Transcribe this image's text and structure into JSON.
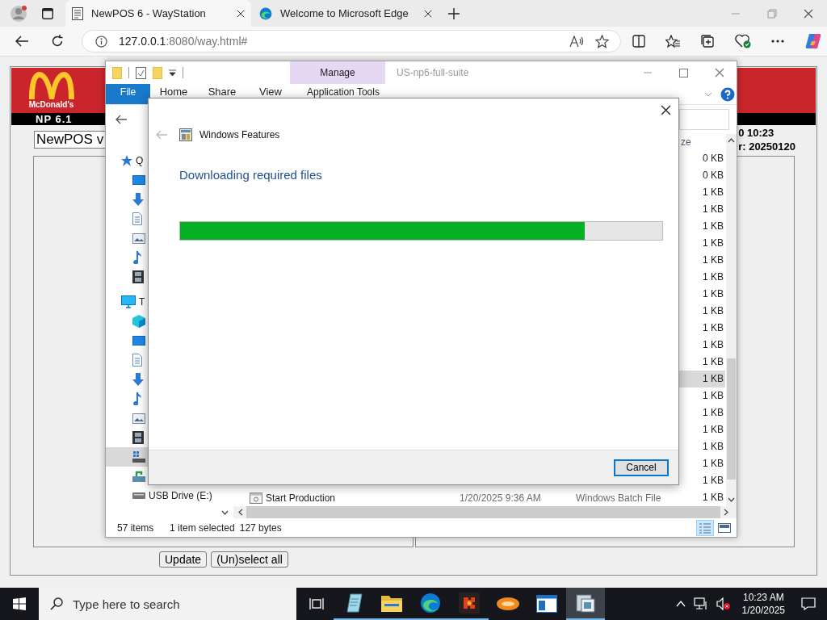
{
  "browser": {
    "tabs": [
      {
        "title": "NewPOS 6 - WayStation",
        "kind": "page",
        "selected": true
      },
      {
        "title": "Welcome to Microsoft Edge",
        "kind": "edge",
        "selected": false
      }
    ],
    "address": {
      "host": "127.0.0.1",
      "path": ":8080/way.html#"
    }
  },
  "page": {
    "logo_text": "McDonald's",
    "version_label": "NP 6.1",
    "version_field": "NewPOS v",
    "info_lines": [
      "0 10:23",
      "r: 20250120"
    ],
    "buttons": [
      "Update",
      "(Un)select all"
    ]
  },
  "explorer": {
    "context_tab": "Manage",
    "title": "US-np6-full-suite",
    "ribbon_tabs": [
      {
        "label": "File",
        "kind": "file"
      },
      {
        "label": "Home",
        "kind": "tab"
      },
      {
        "label": "Share",
        "kind": "tab"
      },
      {
        "label": "View",
        "kind": "tab"
      },
      {
        "label": "Application Tools",
        "kind": "context"
      }
    ],
    "sidebar": [
      {
        "kind": "star",
        "label": "Q",
        "selected": false,
        "children": [
          {
            "kind": "desktop",
            "selected": false
          },
          {
            "kind": "download",
            "selected": false
          },
          {
            "kind": "document",
            "selected": false
          },
          {
            "kind": "picture",
            "selected": false
          },
          {
            "kind": "music",
            "selected": false
          },
          {
            "kind": "video",
            "selected": false
          }
        ]
      },
      {
        "kind": "pc",
        "label": "T",
        "selected": false,
        "children": [
          {
            "kind": "cube",
            "selected": false
          },
          {
            "kind": "desktop",
            "selected": false
          },
          {
            "kind": "document",
            "selected": false
          },
          {
            "kind": "download",
            "selected": false
          },
          {
            "kind": "music",
            "selected": false
          },
          {
            "kind": "picture",
            "selected": false
          },
          {
            "kind": "video",
            "selected": false
          },
          {
            "kind": "drive",
            "selected": true
          },
          {
            "kind": "netdrive",
            "selected": false
          },
          {
            "kind": "usb",
            "label": "USB Drive (E:)",
            "selected": false
          }
        ]
      }
    ],
    "columns": [
      {
        "label": "ze"
      }
    ],
    "rows": [
      {
        "size": "0 KB",
        "selected": false
      },
      {
        "size": "0 KB",
        "selected": false
      },
      {
        "size": "1 KB",
        "selected": false
      },
      {
        "size": "1 KB",
        "selected": false
      },
      {
        "size": "1 KB",
        "selected": false
      },
      {
        "size": "1 KB",
        "selected": false
      },
      {
        "size": "1 KB",
        "selected": false
      },
      {
        "size": "1 KB",
        "selected": false
      },
      {
        "size": "1 KB",
        "selected": false
      },
      {
        "size": "1 KB",
        "selected": false
      },
      {
        "size": "1 KB",
        "selected": false
      },
      {
        "size": "1 KB",
        "selected": false
      },
      {
        "size": "1 KB",
        "selected": false
      },
      {
        "size": "1 KB",
        "selected": true
      },
      {
        "size": "1 KB",
        "selected": false
      },
      {
        "size": "1 KB",
        "selected": false
      },
      {
        "size": "1 KB",
        "selected": false
      },
      {
        "size": "1 KB",
        "selected": false
      },
      {
        "size": "1 KB",
        "selected": false
      },
      {
        "size": "1 KB",
        "selected": false
      },
      {
        "name": "Start Production",
        "date": "1/20/2025 9:36 AM",
        "type": "Windows Batch File",
        "size": "1 KB",
        "selected": false
      }
    ],
    "status": {
      "items": "57 items",
      "selection": "1 item selected",
      "size": "127 bytes"
    },
    "views": [
      {
        "kind": "details",
        "selected": true
      },
      {
        "kind": "tiles",
        "selected": false
      }
    ]
  },
  "dialog": {
    "title": "Windows Features",
    "heading": "Downloading required files",
    "progress": {
      "level": 0.84
    },
    "buttons": [
      "Cancel"
    ]
  },
  "taskbar": {
    "search": {
      "placeholder": "Type here to search"
    },
    "apps": [
      {
        "kind": "notepad",
        "running": true,
        "selected": false
      },
      {
        "kind": "folder",
        "running": true,
        "selected": false
      },
      {
        "kind": "edge",
        "running": true,
        "selected": false
      },
      {
        "kind": "puzzle",
        "running": true,
        "selected": false
      },
      {
        "kind": "oval",
        "running": false,
        "selected": false
      },
      {
        "kind": "window",
        "running": false,
        "selected": false
      },
      {
        "kind": "explorer",
        "running": true,
        "selected": true
      }
    ],
    "clock": {
      "time": "10:23 AM",
      "date": "1/20/2025"
    }
  }
}
